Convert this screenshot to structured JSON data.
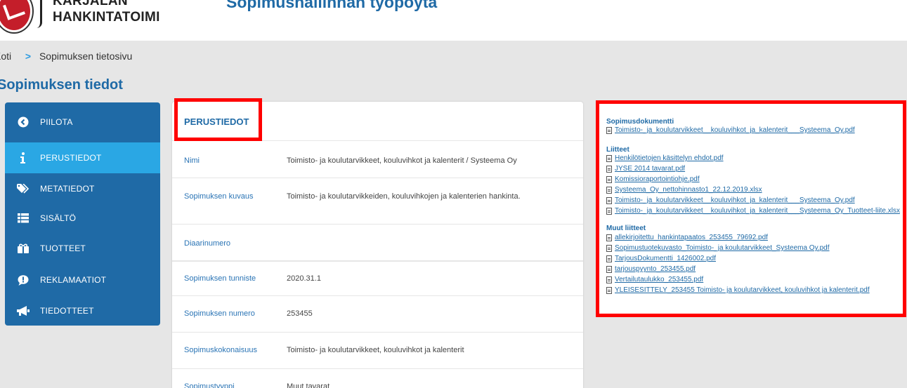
{
  "header": {
    "logo_line1": "KARJALAN",
    "logo_line2": "HANKINTATOIMI",
    "app_title": "Sopimushallinnan työpöytä"
  },
  "breadcrumb": {
    "home": "Koti",
    "separator": ">",
    "current": "Sopimuksen tietosivu"
  },
  "page_title": "Sopimuksen tiedot",
  "sidebar": {
    "items": [
      {
        "label": "PIILOTA",
        "icon": "chevron-left-icon"
      },
      {
        "label": "PERUSTIEDOT",
        "icon": "info-icon",
        "active": true
      },
      {
        "label": "METATIEDOT",
        "icon": "tags-icon"
      },
      {
        "label": "SISÄLTÖ",
        "icon": "list-icon"
      },
      {
        "label": "TUOTTEET",
        "icon": "gift-icon"
      },
      {
        "label": "REKLAMAATIOT",
        "icon": "comment-alert-icon"
      },
      {
        "label": "TIEDOTTEET",
        "icon": "megaphone-icon"
      }
    ],
    "active_color": "#2aa7e4",
    "bg_color": "#1f6aa6"
  },
  "main": {
    "section_title": "PERUSTIEDOT",
    "rows": [
      {
        "label": "Nimi",
        "value": "Toimisto- ja koulutarvikkeet, kouluvihkot ja kalenterit / Systeema Oy"
      },
      {
        "label": "Sopimuksen kuvaus",
        "value": "Toimisto- ja koulutarvikkeiden, kouluvihkojen ja kalenterien hankinta."
      },
      {
        "label": "Diaarinumero",
        "value": ""
      },
      {
        "label": "Sopimuksen tunniste",
        "value": "2020.31.1"
      },
      {
        "label": "Sopimuksen numero",
        "value": "253455"
      },
      {
        "label": "Sopimuskokonaisuus",
        "value": "Toimisto- ja koulutarvikkeet, kouluvihkot ja kalenterit"
      },
      {
        "label": "Sopimustyyppi",
        "value": "Muut tavarat"
      }
    ]
  },
  "documents": {
    "contract_heading": "Sopimusdokumentti",
    "contract_docs": [
      "Toimisto-_ja_koulutarvikkeet__kouluvihkot_ja_kalenterit___Systeema_Oy.pdf"
    ],
    "attachments_heading": "Liitteet",
    "attachments": [
      "Henkilötietojen käsittelyn ehdot.pdf",
      "JYSE 2014 tavarat.pdf",
      "Komissioraportointiohje.pdf",
      "Systeema_Oy_nettohinnasto1_22.12.2019.xlsx",
      "Toimisto-_ja_koulutarvikkeet__kouluvihkot_ja_kalenterit___Systeema_Oy.pdf",
      "Toimisto-_ja_koulutarvikkeet__kouluvihkot_ja_kalenterit___Systeema_Oy_Tuotteet-liite.xlsx"
    ],
    "other_heading": "Muut liitteet",
    "other_attachments": [
      "allekirjoitettu_hankintapaatos_253455_79692.pdf",
      "Sopimustuotekuvasto_Toimisto-_ja koulutarvikkeet_Systeema Oy.pdf",
      "TarjousDokumentti_1426002.pdf",
      "tarjouspyynto_253455.pdf",
      "Vertailutaulukko_253455.pdf",
      "YLEISESITTELY_253455 Toimisto- ja koulutarvikkeet, kouluvihkot ja kalenterit.pdf"
    ]
  },
  "colors": {
    "accent": "#1f6aa6",
    "highlight": "#ff0000",
    "link": "#1f6aa6"
  }
}
